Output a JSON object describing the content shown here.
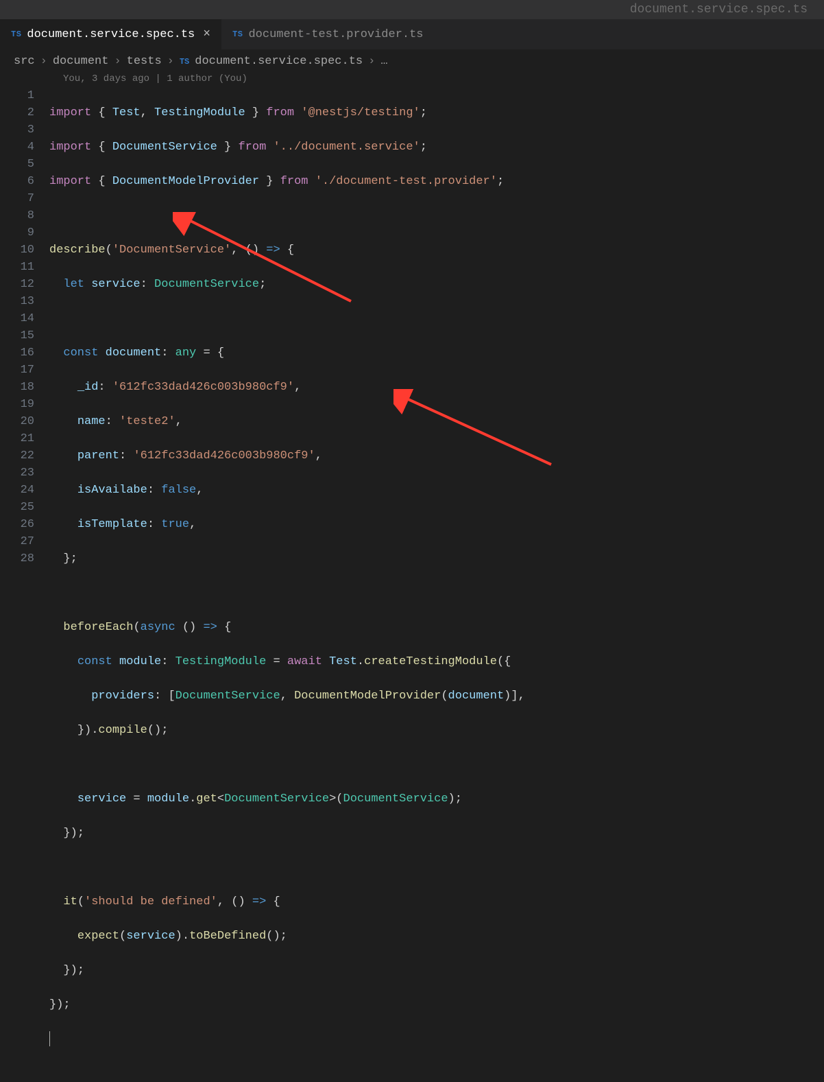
{
  "titlebar": {
    "text": "document.service.spec.ts"
  },
  "tabs": [
    {
      "badge": "TS",
      "name": "document.service.spec.ts",
      "active": true,
      "close": "×"
    },
    {
      "badge": "TS",
      "name": "document-test.provider.ts",
      "active": false
    }
  ],
  "breadcrumb": {
    "seg1": "src",
    "seg2": "document",
    "seg3": "tests",
    "badge": "TS",
    "seg4": "document.service.spec.ts",
    "trailing": "…",
    "chev": "›"
  },
  "blame": "You, 3 days ago | 1 author (You)",
  "lineNumbers": [
    "1",
    "2",
    "3",
    "4",
    "5",
    "6",
    "7",
    "8",
    "9",
    "10",
    "11",
    "12",
    "13",
    "14",
    "15",
    "16",
    "17",
    "18",
    "19",
    "20",
    "21",
    "22",
    "23",
    "24",
    "25",
    "26",
    "27",
    "28"
  ],
  "code": {
    "l1": {
      "import": "import",
      "lb": "{ ",
      "a": "Test",
      "c1": ", ",
      "b": "TestingModule",
      "rb": " }",
      "from": "from",
      "s": "'@nestjs/testing'",
      "sc": ";"
    },
    "l2": {
      "import": "import",
      "lb": "{ ",
      "a": "DocumentService",
      "rb": " }",
      "from": "from",
      "s": "'../document.service'",
      "sc": ";"
    },
    "l3": {
      "import": "import",
      "lb": "{ ",
      "a": "DocumentModelProvider",
      "rb": " }",
      "from": "from",
      "s": "'./document-test.provider'",
      "sc": ";"
    },
    "l5": {
      "fn": "describe",
      "open": "(",
      "s": "'DocumentService'",
      "c": ", () ",
      "arrow": "=>",
      "b": " {"
    },
    "l6": {
      "let": "let",
      "id": "service",
      "col": ": ",
      "type": "DocumentService",
      "sc": ";"
    },
    "l8": {
      "const": "const",
      "id": "document",
      "col": ": ",
      "type": "any",
      "eq": " = {"
    },
    "l9": {
      "prop": "_id",
      "col": ": ",
      "val": "'612fc33dad426c003b980cf9'",
      "c": ","
    },
    "l10": {
      "prop": "name",
      "col": ": ",
      "val": "'teste2'",
      "c": ","
    },
    "l11": {
      "prop": "parent",
      "col": ": ",
      "val": "'612fc33dad426c003b980cf9'",
      "c": ","
    },
    "l12": {
      "prop": "isAvailabe",
      "col": ": ",
      "val": "false",
      "c": ","
    },
    "l13": {
      "prop": "isTemplate",
      "col": ": ",
      "val": "true",
      "c": ","
    },
    "l14": {
      "close": "};"
    },
    "l16": {
      "fn": "beforeEach",
      "open": "(",
      "async": "async",
      "rest": " () ",
      "arrow": "=>",
      "b": " {"
    },
    "l17": {
      "const": "const",
      "id": "module",
      "col": ": ",
      "type": "TestingModule",
      "eq": " = ",
      "await": "await",
      "sp": " ",
      "obj": "Test",
      "dot": ".",
      "m": "createTestingModule",
      "open": "({"
    },
    "l18": {
      "prop": "providers",
      "col": ": [",
      "t1": "DocumentService",
      "c1": ", ",
      "t2": "DocumentModelProvider",
      "open": "(",
      "arg": "document",
      "close": ")],",
      "end": ""
    },
    "l19": {
      "close": "}).",
      "fn": "compile",
      "rest": "();"
    },
    "l21": {
      "id": "service",
      "eq": " = ",
      "obj": "module",
      "dot": ".",
      "m": "get",
      "lt": "<",
      "type": "DocumentService",
      "gt": ">(",
      "arg": "DocumentService",
      "close": ");"
    },
    "l22": {
      "close": "});"
    },
    "l24": {
      "fn": "it",
      "open": "(",
      "s": "'should be defined'",
      "c": ", () ",
      "arrow": "=>",
      "b": " {"
    },
    "l25": {
      "fn": "expect",
      "open": "(",
      "id": "service",
      "close": ").",
      "m": "toBeDefined",
      "rest": "();"
    },
    "l26": {
      "close": "});"
    },
    "l27": {
      "close": "});"
    }
  }
}
